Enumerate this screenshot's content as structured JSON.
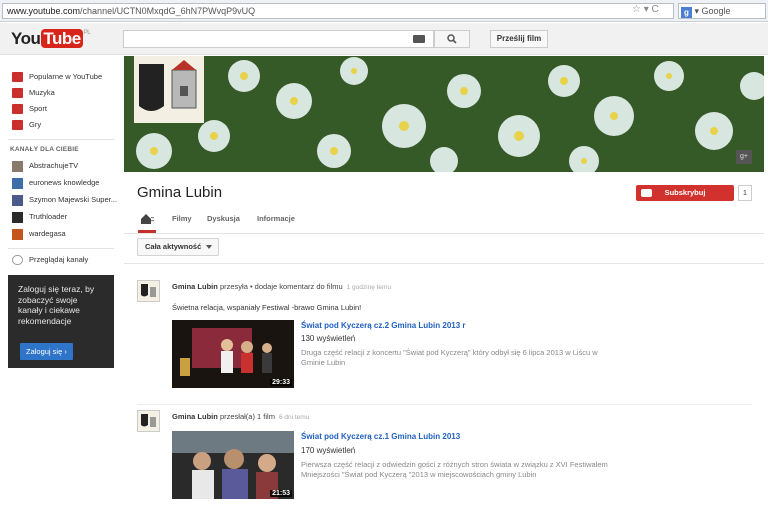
{
  "browser": {
    "url_domain": "www.youtube.com",
    "url_path": "/channel/UCTN0MxqdG_6hN7PWvqP9vUQ",
    "search_engine": "Google",
    "url_bar_icons": "☆ ▾ C"
  },
  "header": {
    "logo_you": "You",
    "logo_tube": "Tube",
    "logo_region": "PL",
    "upload_label": "Prześlij film"
  },
  "sidebar": {
    "nav": [
      {
        "label": "Popularne w YouTube",
        "icon": "popular-icon"
      },
      {
        "label": "Muzyka",
        "icon": "music-icon"
      },
      {
        "label": "Sport",
        "icon": "sport-icon"
      },
      {
        "label": "Gry",
        "icon": "games-icon"
      }
    ],
    "channels_title": "KANAŁY DLA CIEBIE",
    "channels": [
      {
        "label": "AbstrachujeTV"
      },
      {
        "label": "euronews knowledge"
      },
      {
        "label": "Szymon Majewski Super..."
      },
      {
        "label": "Truthloader"
      },
      {
        "label": "wardegasa"
      }
    ],
    "browse_label": "Przeglądaj kanały",
    "signin_text": "Zaloguj się teraz, by zobaczyć swoje kanały i ciekawe rekomendacje",
    "signin_button": "Zaloguj się ›"
  },
  "channel": {
    "title": "Gmina Lubin",
    "subscribe_label": "Subskrybuj",
    "subscriber_count": "1",
    "tabs": [
      {
        "label": "Filmy"
      },
      {
        "label": "Dyskusja"
      },
      {
        "label": "Informacje"
      }
    ],
    "activity_filter": "Cała aktywność"
  },
  "feed": [
    {
      "author": "Gmina Lubin",
      "action": "przesyła • dodaje komentarz do filmu",
      "time": "1 godzinę temu",
      "comment": "Świetna relacja, wspaniały Festiwal -brawo Gmina Lubin!",
      "video_title": "Świat pod Kyczerą cz.2 Gmina Lubin 2013 r",
      "views": "130 wyświetleń",
      "duration": "29:33",
      "description": "Druga część relacji z koncertu \"Świat pod Kyczerą\" który odbył się 6 lipca 2013 w Liścu w Gminie Lubin"
    },
    {
      "author": "Gmina Lubin",
      "action": "przesłał(a) 1 film",
      "time": "6 dni temu",
      "video_title": "Świat pod Kyczerą cz.1 Gmina Lubin 2013",
      "views": "170 wyświetleń",
      "duration": "21:53",
      "description": "Pierwsza część relacji z odwiedzin gości z różnych stron świata w związku z XVI Festiwalem Mniejszości \"Świat pod Kyczerą \"2013 w miejscowościach gminy Lubin"
    }
  ],
  "colors": {
    "brand_red": "#d7251c",
    "subscribe_red": "#d2322d",
    "link_blue": "#2160bf",
    "signin_blue": "#2e74c9"
  }
}
